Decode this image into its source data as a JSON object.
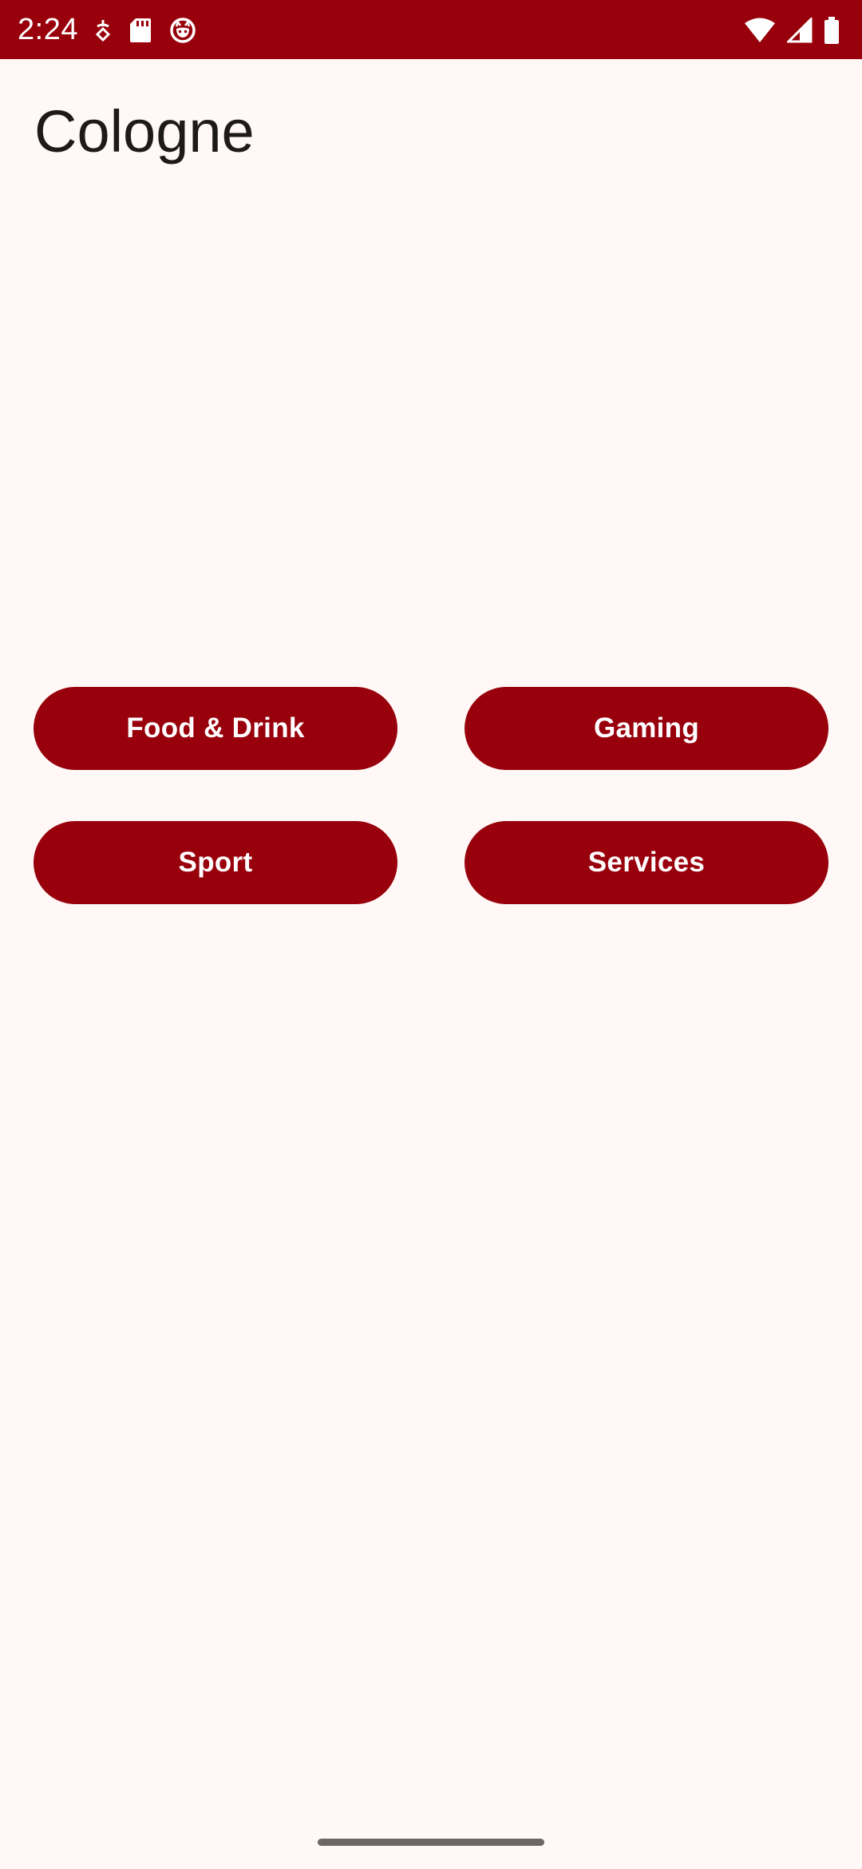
{
  "status_bar": {
    "time": "2:24",
    "left_icons": [
      "usb-debug-icon",
      "sd-card-icon",
      "cat-face-icon"
    ],
    "right_icons": [
      "wifi-icon",
      "cell-signal-icon",
      "battery-icon"
    ],
    "color": "#98000B"
  },
  "app_bar": {
    "title": "Cologne"
  },
  "categories": [
    {
      "label": "Food & Drink"
    },
    {
      "label": "Gaming"
    },
    {
      "label": "Sport"
    },
    {
      "label": "Services"
    }
  ],
  "colors": {
    "primary": "#98000B",
    "background": "#FFF8F6",
    "on_primary": "#FFFFFF",
    "title_text": "#1F1A1A"
  }
}
